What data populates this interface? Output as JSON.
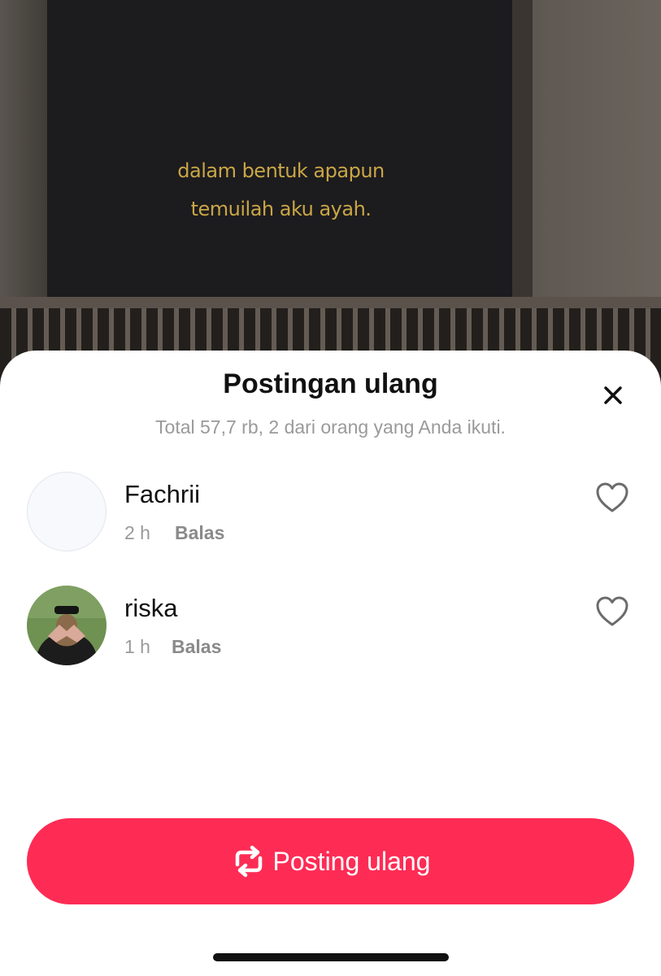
{
  "video": {
    "caption_line1": "dalam bentuk apapun",
    "caption_line2": "temuilah aku ayah."
  },
  "sheet": {
    "title": "Postingan ulang",
    "subtitle": "Total 57,7 rb, 2 dari orang yang Anda ikuti.",
    "close_icon": "close-icon",
    "users": [
      {
        "name": "Fachrii",
        "time": "2 h",
        "reply_label": "Balas",
        "liked": false
      },
      {
        "name": "riska",
        "time": "1 h",
        "reply_label": "Balas",
        "liked": false
      }
    ],
    "repost_button": {
      "label": "Posting ulang",
      "icon": "repost-icon",
      "color": "#fe2c55"
    }
  },
  "colors": {
    "accent": "#fe2c55",
    "caption": "#c9a646"
  }
}
